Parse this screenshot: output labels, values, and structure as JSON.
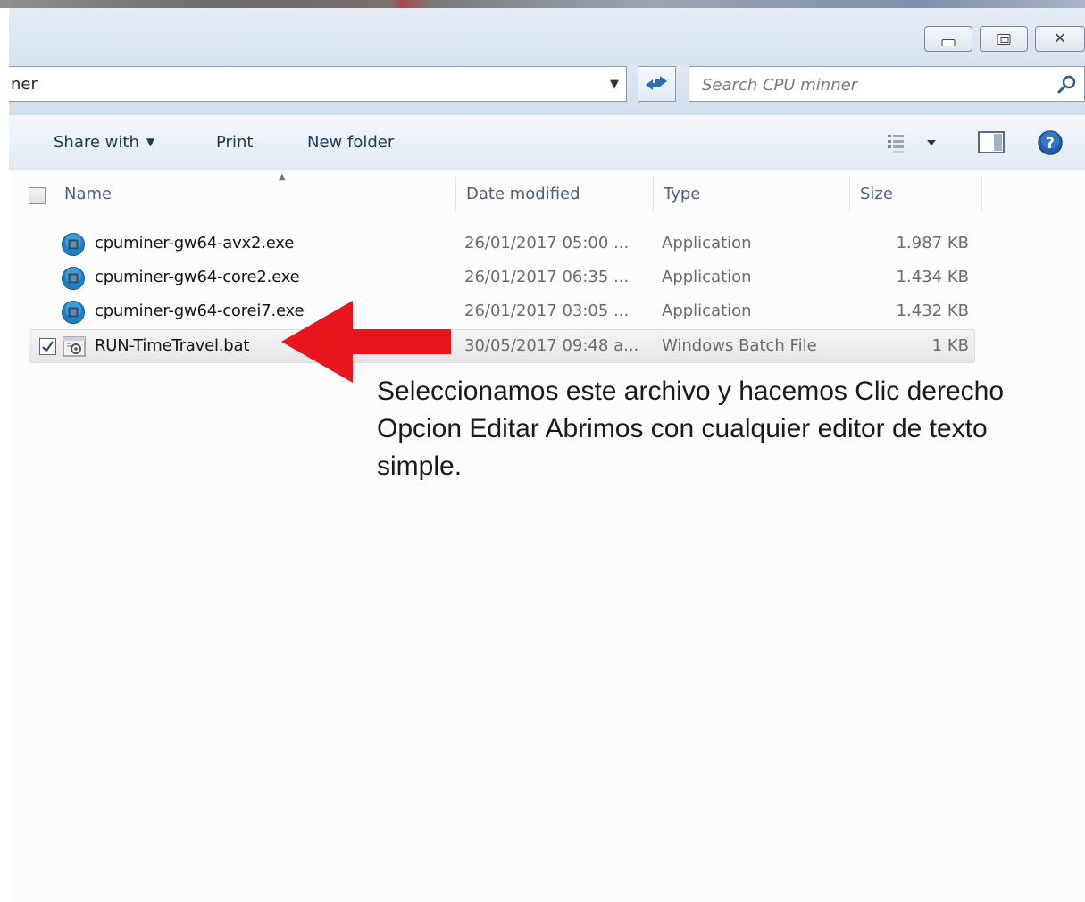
{
  "window": {
    "controls": {
      "minimize": "minimize",
      "maximize": "maximize",
      "close": "close"
    }
  },
  "address": {
    "path_fragment": "ner",
    "refresh_icon": "refresh-icon"
  },
  "search": {
    "placeholder": "Search CPU minner",
    "icon": "search-icon"
  },
  "toolbar": {
    "share_with": "Share with",
    "print": "Print",
    "new_folder": "New folder"
  },
  "columns": {
    "name": "Name",
    "date_modified": "Date modified",
    "type": "Type",
    "size": "Size"
  },
  "files": [
    {
      "name": "cpuminer-gw64-avx2.exe",
      "date": "26/01/2017 05:00 ...",
      "type": "Application",
      "size": "1.987 KB",
      "icon": "application-icon",
      "selected": false
    },
    {
      "name": "cpuminer-gw64-core2.exe",
      "date": "26/01/2017 06:35 ...",
      "type": "Application",
      "size": "1.434 KB",
      "icon": "application-icon",
      "selected": false
    },
    {
      "name": "cpuminer-gw64-corei7.exe",
      "date": "26/01/2017 03:05 ...",
      "type": "Application",
      "size": "1.432 KB",
      "icon": "application-icon",
      "selected": false
    },
    {
      "name": "RUN-TimeTravel.bat",
      "date": "30/05/2017 09:48 a...",
      "type": "Windows Batch File",
      "size": "1 KB",
      "icon": "batch-file-icon",
      "selected": true
    }
  ],
  "annotation": {
    "lines": [
      "Seleccionamos este archivo y hacemos Clic derecho",
      "Opcion Editar Abrimos con cualquier editor de texto",
      "simple."
    ],
    "arrow_color": "#e8161c"
  },
  "colors": {
    "accent_blue": "#1e7fc4",
    "toolbar_text": "#1e3953"
  }
}
